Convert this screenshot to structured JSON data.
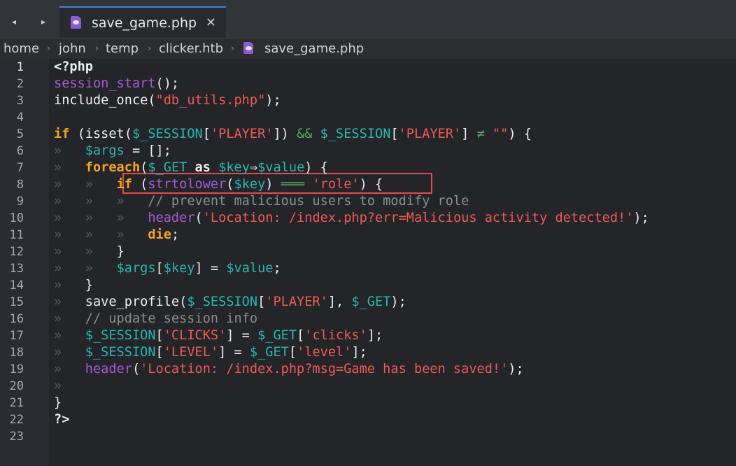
{
  "tabbar": {
    "back_glyph": "◂",
    "forward_glyph": "▸",
    "tab": {
      "label": "save_game.php",
      "close_glyph": "✕",
      "icon": "php-file-icon"
    }
  },
  "breadcrumb": {
    "separator": "›",
    "items": [
      "home",
      "john",
      "temp",
      "clicker.htb",
      "save_game.php"
    ]
  },
  "editor": {
    "current_line": 1,
    "highlighted_line": 8,
    "colors": {
      "keyword": "#f3a524",
      "function": "#a65ad6",
      "variable": "#27b7b1",
      "string": "#f05a55",
      "comment": "#8a8d93",
      "highlight_box": "#e74a4a"
    },
    "line_numbers": [
      "1",
      "2",
      "3",
      "4",
      "5",
      "6",
      "7",
      "8",
      "9",
      "10",
      "11",
      "12",
      "13",
      "14",
      "15",
      "16",
      "17",
      "18",
      "19",
      "20",
      "21",
      "22",
      "23"
    ],
    "lines": [
      {
        "tokens": [
          {
            "t": "<?php",
            "c": "tok-bold"
          }
        ]
      },
      {
        "tokens": [
          {
            "t": "session_start",
            "c": "tok-fn"
          },
          {
            "t": "();",
            "c": "tok-plain"
          }
        ]
      },
      {
        "tokens": [
          {
            "t": "include_once",
            "c": "tok-plain"
          },
          {
            "t": "(",
            "c": "tok-plain"
          },
          {
            "t": "\"db_utils.php\"",
            "c": "tok-str"
          },
          {
            "t": ");",
            "c": "tok-plain"
          }
        ]
      },
      {
        "tokens": []
      },
      {
        "tokens": [
          {
            "t": "if",
            "c": "tok-kw"
          },
          {
            "t": " (isset(",
            "c": "tok-plain"
          },
          {
            "t": "$_SESSION",
            "c": "tok-var"
          },
          {
            "t": "[",
            "c": "tok-plain"
          },
          {
            "t": "'PLAYER'",
            "c": "tok-str"
          },
          {
            "t": "]) ",
            "c": "tok-plain"
          },
          {
            "t": "&&",
            "c": "tok-op"
          },
          {
            "t": " ",
            "c": "tok-plain"
          },
          {
            "t": "$_SESSION",
            "c": "tok-var"
          },
          {
            "t": "[",
            "c": "tok-plain"
          },
          {
            "t": "'PLAYER'",
            "c": "tok-str"
          },
          {
            "t": "] ",
            "c": "tok-plain"
          },
          {
            "t": "≠",
            "c": "tok-op"
          },
          {
            "t": " ",
            "c": "tok-plain"
          },
          {
            "t": "\"\"",
            "c": "tok-str"
          },
          {
            "t": ") {",
            "c": "tok-plain"
          }
        ]
      },
      {
        "tokens": [
          {
            "t": "»   ",
            "c": "tok-tab"
          },
          {
            "t": "$args",
            "c": "tok-var"
          },
          {
            "t": " = [];",
            "c": "tok-plain"
          }
        ]
      },
      {
        "tokens": [
          {
            "t": "»   ",
            "c": "tok-tab"
          },
          {
            "t": "foreach",
            "c": "tok-kw"
          },
          {
            "t": "(",
            "c": "tok-plain"
          },
          {
            "t": "$_GET",
            "c": "tok-var"
          },
          {
            "t": " as ",
            "c": "tok-bold"
          },
          {
            "t": "$key",
            "c": "tok-var"
          },
          {
            "t": "⇒",
            "c": "tok-plain"
          },
          {
            "t": "$value",
            "c": "tok-var"
          },
          {
            "t": ") {",
            "c": "tok-plain"
          }
        ]
      },
      {
        "tokens": [
          {
            "t": "»   ",
            "c": "tok-tab"
          },
          {
            "t": "»   ",
            "c": "tok-tab"
          },
          {
            "t": "if",
            "c": "tok-kw"
          },
          {
            "t": " (",
            "c": "tok-plain"
          },
          {
            "t": "strtolower",
            "c": "tok-fn"
          },
          {
            "t": "(",
            "c": "tok-plain"
          },
          {
            "t": "$key",
            "c": "tok-var"
          },
          {
            "t": ") ",
            "c": "tok-plain"
          },
          {
            "t": "═══",
            "c": "tok-op"
          },
          {
            "t": " ",
            "c": "tok-plain"
          },
          {
            "t": "'role'",
            "c": "tok-str"
          },
          {
            "t": ") {",
            "c": "tok-plain"
          }
        ]
      },
      {
        "tokens": [
          {
            "t": "»   ",
            "c": "tok-tab"
          },
          {
            "t": "»   ",
            "c": "tok-tab"
          },
          {
            "t": "»   ",
            "c": "tok-tab"
          },
          {
            "t": "// prevent malicious users to modify role",
            "c": "tok-cmt"
          }
        ]
      },
      {
        "tokens": [
          {
            "t": "»   ",
            "c": "tok-tab"
          },
          {
            "t": "»   ",
            "c": "tok-tab"
          },
          {
            "t": "»   ",
            "c": "tok-tab"
          },
          {
            "t": "header",
            "c": "tok-fn"
          },
          {
            "t": "(",
            "c": "tok-plain"
          },
          {
            "t": "'Location: /index.php?err=Malicious activity detected!'",
            "c": "tok-str"
          },
          {
            "t": ");",
            "c": "tok-plain"
          }
        ]
      },
      {
        "tokens": [
          {
            "t": "»   ",
            "c": "tok-tab"
          },
          {
            "t": "»   ",
            "c": "tok-tab"
          },
          {
            "t": "»   ",
            "c": "tok-tab"
          },
          {
            "t": "die",
            "c": "tok-kw"
          },
          {
            "t": ";",
            "c": "tok-plain"
          }
        ]
      },
      {
        "tokens": [
          {
            "t": "»   ",
            "c": "tok-tab"
          },
          {
            "t": "»   ",
            "c": "tok-tab"
          },
          {
            "t": "}",
            "c": "tok-plain"
          }
        ]
      },
      {
        "tokens": [
          {
            "t": "»   ",
            "c": "tok-tab"
          },
          {
            "t": "»   ",
            "c": "tok-tab"
          },
          {
            "t": "$args",
            "c": "tok-var"
          },
          {
            "t": "[",
            "c": "tok-plain"
          },
          {
            "t": "$key",
            "c": "tok-var"
          },
          {
            "t": "] = ",
            "c": "tok-plain"
          },
          {
            "t": "$value",
            "c": "tok-var"
          },
          {
            "t": ";",
            "c": "tok-plain"
          }
        ]
      },
      {
        "tokens": [
          {
            "t": "»   ",
            "c": "tok-tab"
          },
          {
            "t": "}",
            "c": "tok-plain"
          }
        ]
      },
      {
        "tokens": [
          {
            "t": "»   ",
            "c": "tok-tab"
          },
          {
            "t": "save_profile(",
            "c": "tok-plain"
          },
          {
            "t": "$_SESSION",
            "c": "tok-var"
          },
          {
            "t": "[",
            "c": "tok-plain"
          },
          {
            "t": "'PLAYER'",
            "c": "tok-str"
          },
          {
            "t": "], ",
            "c": "tok-plain"
          },
          {
            "t": "$_GET",
            "c": "tok-var"
          },
          {
            "t": ");",
            "c": "tok-plain"
          }
        ]
      },
      {
        "tokens": [
          {
            "t": "»   ",
            "c": "tok-tab"
          },
          {
            "t": "// update session info",
            "c": "tok-cmt"
          }
        ]
      },
      {
        "tokens": [
          {
            "t": "»   ",
            "c": "tok-tab"
          },
          {
            "t": "$_SESSION",
            "c": "tok-var"
          },
          {
            "t": "[",
            "c": "tok-plain"
          },
          {
            "t": "'CLICKS'",
            "c": "tok-str"
          },
          {
            "t": "] = ",
            "c": "tok-plain"
          },
          {
            "t": "$_GET",
            "c": "tok-var"
          },
          {
            "t": "[",
            "c": "tok-plain"
          },
          {
            "t": "'clicks'",
            "c": "tok-str"
          },
          {
            "t": "];",
            "c": "tok-plain"
          }
        ]
      },
      {
        "tokens": [
          {
            "t": "»   ",
            "c": "tok-tab"
          },
          {
            "t": "$_SESSION",
            "c": "tok-var"
          },
          {
            "t": "[",
            "c": "tok-plain"
          },
          {
            "t": "'LEVEL'",
            "c": "tok-str"
          },
          {
            "t": "] = ",
            "c": "tok-plain"
          },
          {
            "t": "$_GET",
            "c": "tok-var"
          },
          {
            "t": "[",
            "c": "tok-plain"
          },
          {
            "t": "'level'",
            "c": "tok-str"
          },
          {
            "t": "];",
            "c": "tok-plain"
          }
        ]
      },
      {
        "tokens": [
          {
            "t": "»   ",
            "c": "tok-tab"
          },
          {
            "t": "header",
            "c": "tok-fn"
          },
          {
            "t": "(",
            "c": "tok-plain"
          },
          {
            "t": "'Location: /index.php?msg=Game has been saved!'",
            "c": "tok-str"
          },
          {
            "t": ");",
            "c": "tok-plain"
          }
        ]
      },
      {
        "tokens": [
          {
            "t": "»",
            "c": "tok-tab"
          }
        ]
      },
      {
        "tokens": [
          {
            "t": "}",
            "c": "tok-plain"
          }
        ]
      },
      {
        "tokens": [
          {
            "t": "?>",
            "c": "tok-bold"
          }
        ]
      },
      {
        "tokens": []
      }
    ]
  }
}
